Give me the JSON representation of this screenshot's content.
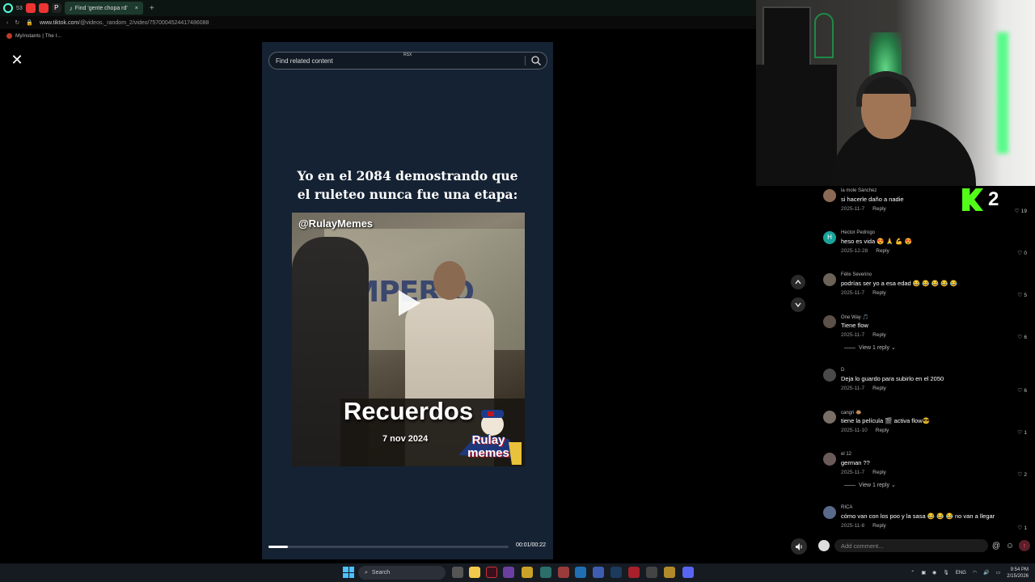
{
  "browser": {
    "tab_number": "53",
    "active_tab_title": "Find 'gente chopa rd'",
    "url_host": "www.tiktok.com",
    "url_path": "/@videos._random_2/video/7570004524417486088",
    "bookmark_label": "MyInstants | The I..."
  },
  "search": {
    "placeholder": "Find related content",
    "badge": "RSX"
  },
  "video": {
    "caption_line1": "Yo en el 2084 demostrando que",
    "caption_line2": "el ruleteo nunca fue una etapa:",
    "watermark": "@RulayMemes",
    "mural_text": "IMPERIO",
    "overlay_title": "Recuerdos",
    "overlay_date": "7 nov 2024",
    "logo_line1": "Rulay",
    "logo_line2": "memes",
    "progress_fraction": 0.08,
    "time": "00:01/00:22"
  },
  "kick": {
    "count": "2",
    "brand_color": "#53fc18"
  },
  "comments": [
    {
      "user": "la mole Sánchez",
      "text": "si hacerle daño a nadie",
      "date": "2025-11-7",
      "likes": "19",
      "avatar_color": "#8a6a55",
      "view_replies": ""
    },
    {
      "user": "Hector Pedrogo",
      "text": "heso es vida 😍 🙏 💪 😍",
      "date": "2025-12-28",
      "likes": "0",
      "avatar_color": "#1aa39a",
      "avatar_letter": "H",
      "view_replies": ""
    },
    {
      "user": "Félix Severino",
      "text": "podrías ser yo a esa edad 😂 😂 😂 😂 😂",
      "date": "2025-11-7",
      "likes": "5",
      "avatar_color": "#6b6258",
      "view_replies": ""
    },
    {
      "user": "One Way 🎵",
      "text": "Tiene flow",
      "date": "2025-11-7",
      "likes": "6",
      "avatar_color": "#5d5048",
      "view_replies": "View 1 reply"
    },
    {
      "user": "D",
      "text": "Deja lo guardo para subirlo en el 2050",
      "date": "2025-11-7",
      "likes": "6",
      "avatar_color": "#4a4a4a",
      "view_replies": ""
    },
    {
      "user": "cangri 🐵",
      "text": "tiene la película 🎬 activa flow😎",
      "date": "2025-11-10",
      "likes": "1",
      "avatar_color": "#7a6f66",
      "view_replies": ""
    },
    {
      "user": "el 12",
      "text": "german ??",
      "date": "2025-11-7",
      "likes": "2",
      "avatar_color": "#6a5a5a",
      "view_replies": "View 1 reply"
    },
    {
      "user": "RICA",
      "text": "cómo van con los poo y la sasa 😂 😂 😂 no van a llegar",
      "date": "2025-11-8",
      "likes": "1",
      "avatar_color": "#5a6a8a",
      "view_replies": ""
    }
  ],
  "comment_box": {
    "placeholder": "Add comment...",
    "reply_label": "Reply"
  },
  "taskbar": {
    "search_label": "Search",
    "language": "ENG",
    "time": "9:54 PM",
    "date": "2/15/2026"
  }
}
